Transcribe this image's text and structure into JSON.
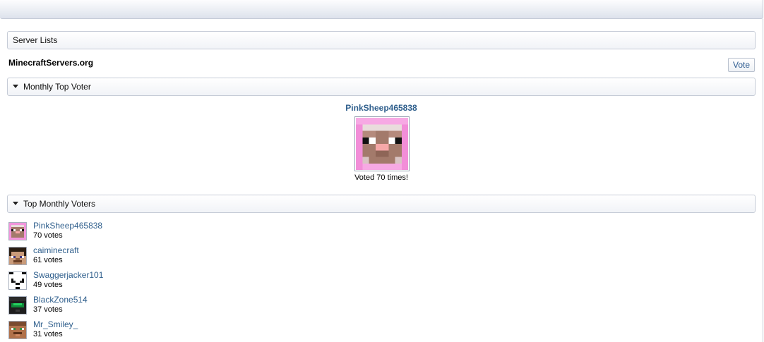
{
  "sections": {
    "server_lists": "Server Lists",
    "monthly_top_voter": "Monthly Top Voter",
    "top_monthly_voters": "Top Monthly Voters"
  },
  "site": {
    "name": "MinecraftServers.org",
    "vote_label": "Vote"
  },
  "top_voter": {
    "name": "PinkSheep465838",
    "count_text": "Voted 70 times!",
    "avatar": "pink-sheep-skin"
  },
  "voters": [
    {
      "name": "PinkSheep465838",
      "votes": "70 votes",
      "avatar": "pink-sheep-skin"
    },
    {
      "name": "caiminecraft",
      "votes": "61 votes",
      "avatar": "steve-skin"
    },
    {
      "name": "Swaggerjacker101",
      "votes": "49 votes",
      "avatar": "panda-skin"
    },
    {
      "name": "BlackZone514",
      "votes": "37 votes",
      "avatar": "green-visor-skin"
    },
    {
      "name": "Mr_Smiley_",
      "votes": "31 votes",
      "avatar": "smiley-skin"
    }
  ],
  "colors": {
    "link": "#2e5e8c",
    "border": "#c6ccd7",
    "sheep_pink": "#f28fd8",
    "sheep_face": "#a07a6a"
  }
}
